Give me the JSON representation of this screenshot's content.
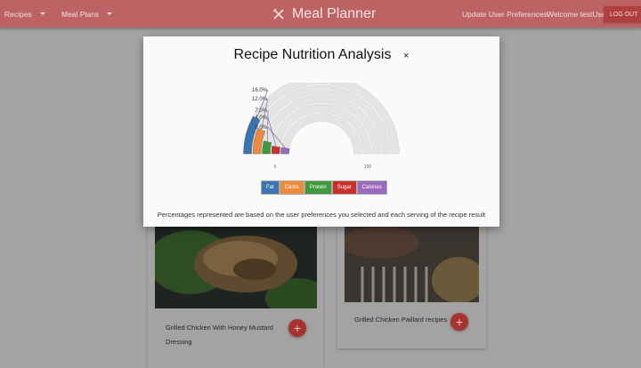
{
  "nav": {
    "recipes_label": "Recipes",
    "meal_plans_label": "Meal Plans",
    "brand": "Meal Planner",
    "preferences_link": "Update User Preferences",
    "welcome": "Welcome testUser",
    "logout": "LOG OUT"
  },
  "cards": [
    {
      "title": "Grilled Chicken With Honey Mustard Dressing",
      "add": "+"
    },
    {
      "title": "Grilled Chicken Paillard recipes",
      "add": "+"
    }
  ],
  "modal": {
    "title": "Recipe Nutrition Analysis",
    "close": "×",
    "footnote": "Percentages represented are based on the user preferences you selected and each serving of the recipe result"
  },
  "chart_data": {
    "type": "radial-bar",
    "series": [
      {
        "name": "Fat",
        "value": 16.0,
        "color": "#3a75b0"
      },
      {
        "name": "Carbs",
        "value": 12.0,
        "color": "#ee8a3a"
      },
      {
        "name": "Protein",
        "value": 7.0,
        "color": "#3f9a3f"
      },
      {
        "name": "Sugar",
        "value": 4.0,
        "color": "#c9302c"
      },
      {
        "name": "Calories",
        "value": 0.0,
        "color": "#9a6bbd"
      }
    ],
    "tick_labels": [
      "16.0%",
      "12.0%",
      "7.0%",
      "4.0%",
      "0.0%"
    ],
    "axis_min_label": "0",
    "axis_max_label": "100",
    "range": [
      0,
      100
    ],
    "track_color": "#e4e4e4"
  }
}
